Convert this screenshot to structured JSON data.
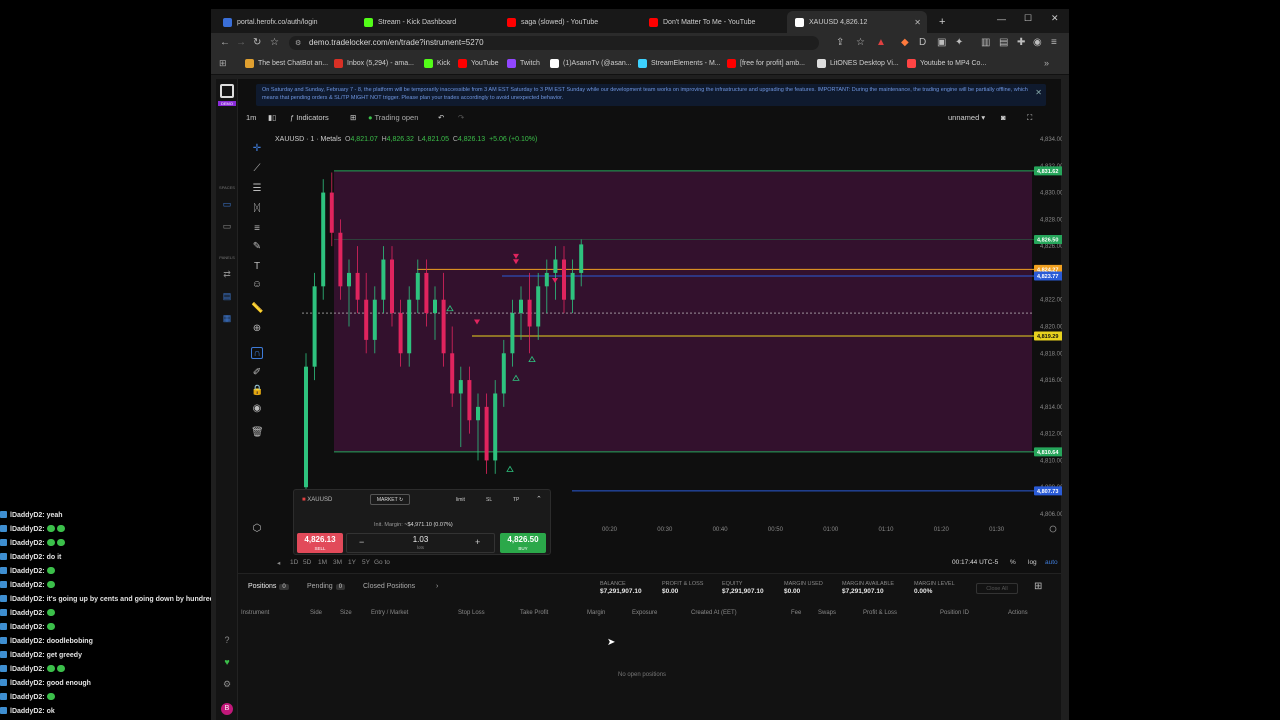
{
  "browser": {
    "tabs": [
      {
        "label": "portal.herofx.co/auth/login",
        "fav_color": "#3a6fd8"
      },
      {
        "label": "Stream - Kick Dashboard",
        "fav_color": "#53fc18"
      },
      {
        "label": "saga (slowed) - YouTube",
        "fav_color": "#ff0000"
      },
      {
        "label": "Don't Matter To Me - YouTube",
        "fav_color": "#ff0000"
      },
      {
        "label": "XAUUSD 4,826.12",
        "fav_color": "#ffffff"
      }
    ],
    "new_tab": "+",
    "url": "demo.tradelocker.com/en/trade?instrument=5270",
    "bookmarks": [
      {
        "label": "The best ChatBot an...",
        "color": "#e0a030"
      },
      {
        "label": "Inbox (5,294) - ama...",
        "color": "#d93025"
      },
      {
        "label": "Kick",
        "color": "#53fc18"
      },
      {
        "label": "YouTube",
        "color": "#ff0000"
      },
      {
        "label": "Twitch",
        "color": "#9146ff"
      },
      {
        "label": "(1)AsanoTv (@asan...",
        "color": "#ffffff"
      },
      {
        "label": "StreamElements - M...",
        "color": "#3dd2ff"
      },
      {
        "label": "[free for profit] amb...",
        "color": "#ff0000"
      },
      {
        "label": "LitONES Desktop Vi...",
        "color": "#dddddd"
      },
      {
        "label": "Youtube to MP4 Co...",
        "color": "#ff4444"
      }
    ]
  },
  "banner": {
    "text": "On Saturday and Sunday, February 7 - 8, the platform will be temporarily inaccessible from 3 AM EST Saturday to 3 PM EST Sunday while our development team works on improving the infrastructure and upgrading the features. IMPORTANT: During the maintenance, the trading engine will be partially offline, which means that pending orders & SL/TP MIGHT NOT trigger. Please plan your trades accordingly to avoid unexpected behavior."
  },
  "rail": {
    "demo_label": "DEMO",
    "spaces_label": "SPACES",
    "panels_label": "PANELS"
  },
  "toolbar": {
    "timeframe": "1m",
    "indicators": "Indicators",
    "trading_open": "Trading open",
    "layout_name": "unnamed"
  },
  "legend": {
    "symbol": "XAUUSD · 1 · Metals",
    "o_label": "O",
    "o": "4,821.07",
    "h_label": "H",
    "h": "4,826.32",
    "l_label": "L",
    "l": "4,821.05",
    "c_label": "C",
    "c": "4,826.13",
    "change": "+5.06 (+0.10%)"
  },
  "chart_data": {
    "type": "candlestick",
    "instrument": "XAUUSD",
    "ylim": [
      4806,
      4834
    ],
    "y_ticks": [
      "4,834.00",
      "4,832.00",
      "4,830.00",
      "4,828.00",
      "4,826.00",
      "4,824.00",
      "4,822.00",
      "4,820.00",
      "4,818.00",
      "4,816.00",
      "4,814.00",
      "4,812.00",
      "4,810.00",
      "4,808.00",
      "4,806.00"
    ],
    "x_ticks": [
      "00:20",
      "00:30",
      "00:40",
      "00:50",
      "01:00",
      "01:10",
      "01:20",
      "01:30"
    ],
    "price_tags": [
      {
        "label": "4,831.62",
        "value": 4831.62,
        "color": "#26a65b"
      },
      {
        "label": "4,826.50",
        "value": 4826.5,
        "color": "#26a65b"
      },
      {
        "label": "4,824.27",
        "value": 4824.27,
        "color": "#f0a020"
      },
      {
        "label": "4,823.77",
        "value": 4823.77,
        "color": "#2a5bd7"
      },
      {
        "label": "4,819.29",
        "value": 4819.29,
        "color": "#e8d21e"
      },
      {
        "label": "4,810.64",
        "value": 4810.64,
        "color": "#26a65b"
      },
      {
        "label": "4,807.73",
        "value": 4807.73,
        "color": "#2a5bd7"
      }
    ],
    "zone": {
      "top": 4831.62,
      "bottom": 4810.64
    },
    "candles": [
      [
        4808,
        4818,
        4807,
        4817
      ],
      [
        4817,
        4824,
        4816,
        4823
      ],
      [
        4823,
        4831,
        4822,
        4830
      ],
      [
        4830,
        4831.5,
        4826,
        4827
      ],
      [
        4827,
        4828,
        4822,
        4823
      ],
      [
        4823,
        4825,
        4820,
        4824
      ],
      [
        4824,
        4826,
        4821,
        4822
      ],
      [
        4822,
        4824,
        4818,
        4819
      ],
      [
        4819,
        4823,
        4818,
        4822
      ],
      [
        4822,
        4826,
        4821,
        4825
      ],
      [
        4825,
        4826,
        4820,
        4821
      ],
      [
        4821,
        4822,
        4817,
        4818
      ],
      [
        4818,
        4823,
        4817,
        4822
      ],
      [
        4822,
        4825,
        4821,
        4824
      ],
      [
        4824,
        4825,
        4820,
        4821
      ],
      [
        4821,
        4823,
        4819,
        4822
      ],
      [
        4822,
        4824,
        4817,
        4818
      ],
      [
        4818,
        4820,
        4814,
        4815
      ],
      [
        4815,
        4817,
        4811,
        4816
      ],
      [
        4816,
        4817,
        4812,
        4813
      ],
      [
        4813,
        4815,
        4810,
        4814
      ],
      [
        4814,
        4815,
        4809,
        4810
      ],
      [
        4810,
        4816,
        4809,
        4815
      ],
      [
        4815,
        4819,
        4814,
        4818
      ],
      [
        4818,
        4822,
        4817,
        4821
      ],
      [
        4821,
        4823,
        4819,
        4822
      ],
      [
        4822,
        4824,
        4818,
        4820
      ],
      [
        4820,
        4824,
        4819,
        4823
      ],
      [
        4823,
        4825,
        4821,
        4824
      ],
      [
        4824,
        4826,
        4822,
        4825
      ],
      [
        4825,
        4826,
        4821,
        4822
      ],
      [
        4822,
        4825,
        4821,
        4824
      ],
      [
        4824,
        4826.5,
        4823,
        4826.13
      ]
    ],
    "sell_markers": [
      4824.8,
      4825.2,
      4823.4,
      4820.3
    ],
    "buy_markers": [
      4821.4,
      4817.6,
      4816.2,
      4809.4
    ]
  },
  "bottombar": {
    "ranges": [
      "1D",
      "5D",
      "1M",
      "3M",
      "1Y",
      "5Y",
      "Go to"
    ],
    "time": "00:17:44 UTC-5",
    "percent": "%",
    "log": "log",
    "auto": "auto"
  },
  "order": {
    "symbol": "XAUUSD",
    "type": "MARKET",
    "tabs": [
      "limit",
      "SL",
      "TP"
    ],
    "init_margin_label": "Init. Margin:",
    "init_margin": "~$4,971.10 (0.07%)",
    "sell_price": "4,826.13",
    "sell_label": "SELL",
    "buy_price": "4,826.50",
    "buy_label": "BUY",
    "lots": "1.03",
    "lots_label": "lots"
  },
  "positions": {
    "tabs": [
      {
        "label": "Positions",
        "count": "0"
      },
      {
        "label": "Pending",
        "count": "0"
      },
      {
        "label": "Closed Positions",
        "count": ""
      }
    ],
    "account": [
      {
        "label": "BALANCE",
        "value": "$7,291,907.10"
      },
      {
        "label": "PROFIT & LOSS",
        "value": "$0.00"
      },
      {
        "label": "EQUITY",
        "value": "$7,291,907.10"
      },
      {
        "label": "MARGIN USED",
        "value": "$0.00"
      },
      {
        "label": "MARGIN AVAILABLE",
        "value": "$7,291,907.10"
      },
      {
        "label": "MARGIN LEVEL",
        "value": "0.00%"
      }
    ],
    "close_all": "Close All",
    "columns": [
      "Instrument",
      "Side",
      "Size",
      "Entry / Market",
      "Stop Loss",
      "Take Profit",
      "Margin",
      "Exposure",
      "Created At (EET)",
      "Fee",
      "Swaps",
      "Profit & Loss",
      "Position ID",
      "Actions"
    ],
    "empty": "No open positions"
  },
  "chat": [
    {
      "user": "lDaddyD2",
      "text": ": yeah",
      "emotes": 0
    },
    {
      "user": "lDaddyD2",
      "text": ":",
      "emotes": 2
    },
    {
      "user": "lDaddyD2",
      "text": ":",
      "emotes": 2
    },
    {
      "user": "lDaddyD2",
      "text": ": do it",
      "emotes": 0
    },
    {
      "user": "lDaddyD2",
      "text": ":",
      "emotes": 1
    },
    {
      "user": "lDaddyD2",
      "text": ":",
      "emotes": 1
    },
    {
      "user": "lDaddyD2",
      "text": ": it's going up by cents and going down by hundreds",
      "emotes": 0
    },
    {
      "user": "lDaddyD2",
      "text": ":",
      "emotes": 1
    },
    {
      "user": "lDaddyD2",
      "text": ":",
      "emotes": 1
    },
    {
      "user": "lDaddyD2",
      "text": ": doodlebobing",
      "emotes": 0
    },
    {
      "user": "lDaddyD2",
      "text": ": get greedy",
      "emotes": 0
    },
    {
      "user": "lDaddyD2",
      "text": ":",
      "emotes": 2
    },
    {
      "user": "lDaddyD2",
      "text": ": good enough",
      "emotes": 0
    },
    {
      "user": "lDaddyD2",
      "text": ":",
      "emotes": 1
    },
    {
      "user": "lDaddyD2",
      "text": ": ok",
      "emotes": 0
    }
  ]
}
